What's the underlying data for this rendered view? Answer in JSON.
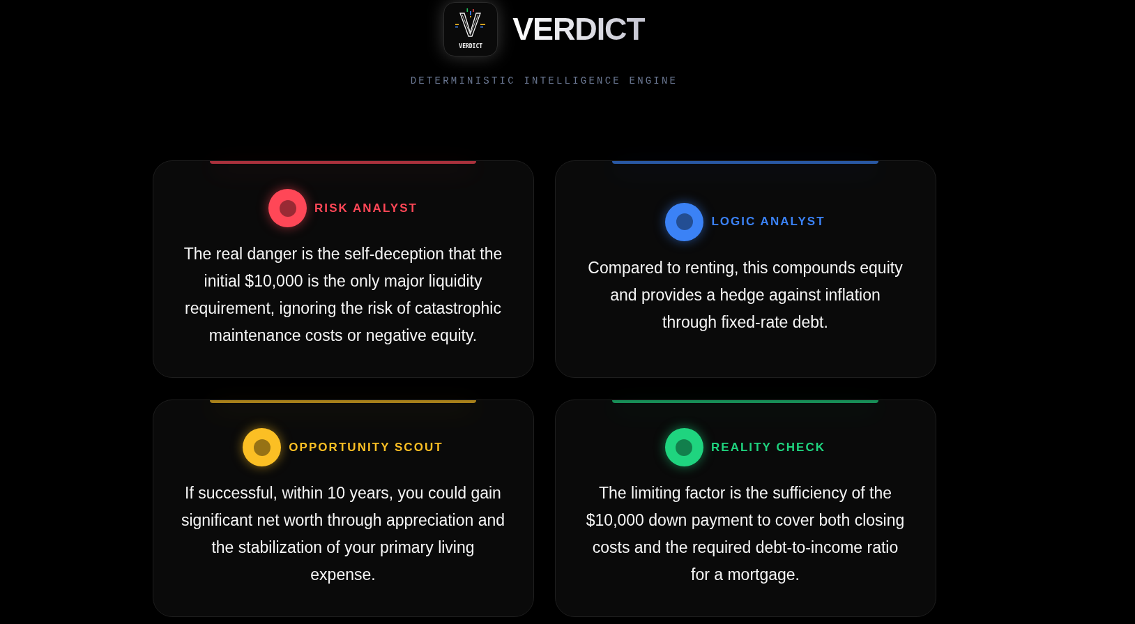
{
  "header": {
    "logo": {
      "wordmark": "VERDICT"
    },
    "title": "VERDICT",
    "tagline": "DETERMINISTIC INTELLIGENCE ENGINE"
  },
  "cards": [
    {
      "label": "RISK ANALYST",
      "color": "#ff4757",
      "text": "The real danger is the self-deception that the initial $10,000 is the only major liquidity requirement, ignoring the risk of catastrophic maintenance costs or negative equity."
    },
    {
      "label": "LOGIC ANALYST",
      "color": "#3b82f6",
      "text": "Compared to renting, this compounds equity and provides a hedge against inflation through fixed-rate debt."
    },
    {
      "label": "OPPORTUNITY SCOUT",
      "color": "#fbbf24",
      "text": "If successful, within 10 years, you could gain significant net worth through appreciation and the stabilization of your primary living expense."
    },
    {
      "label": "REALITY CHECK",
      "color": "#1fd47f",
      "text": "The limiting factor is the sufficiency of the $10,000 down payment to cover both closing costs and the required debt-to-income ratio for a mortgage."
    }
  ]
}
